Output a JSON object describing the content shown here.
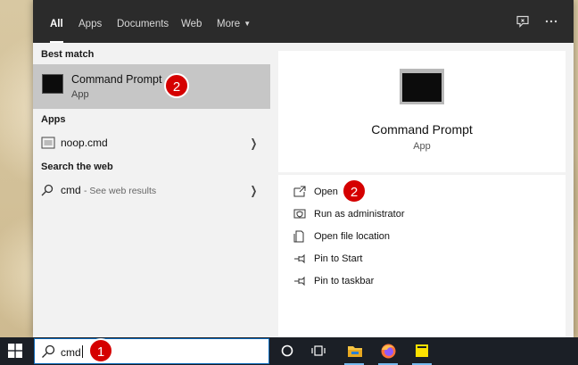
{
  "search_panel": {
    "tabs": [
      {
        "label": "All",
        "active": true
      },
      {
        "label": "Apps"
      },
      {
        "label": "Documents"
      },
      {
        "label": "Web"
      },
      {
        "label": "More"
      }
    ],
    "icons": {
      "feedback": "feedback-icon",
      "more": "more-options-icon"
    }
  },
  "results": {
    "best_match_header": "Best match",
    "best_match": {
      "title": "Command Prompt",
      "subtitle": "App",
      "badge": "2"
    },
    "apps_header": "Apps",
    "apps": [
      {
        "name": "noop.cmd"
      }
    ],
    "web_header": "Search the web",
    "web": {
      "query": "cmd",
      "hint": "- See web results"
    }
  },
  "details": {
    "title": "Command Prompt",
    "subtitle": "App",
    "actions": [
      {
        "label": "Open",
        "icon": "open-icon"
      },
      {
        "label": "Run as administrator",
        "icon": "shield-icon"
      },
      {
        "label": "Open file location",
        "icon": "file-location-icon"
      },
      {
        "label": "Pin to Start",
        "icon": "pin-icon"
      },
      {
        "label": "Pin to taskbar",
        "icon": "pin-icon"
      }
    ],
    "open_badge": "2"
  },
  "taskbar": {
    "search_value": "cmd",
    "search_badge": "1",
    "apps": [
      "cortana",
      "task-view",
      "file-explorer",
      "firefox",
      "sticky-notes"
    ]
  },
  "colors": {
    "badge": "#d50000",
    "taskbar": "#1b1f26",
    "topbar": "#2b2b2b",
    "highlight": "#c6c6c6"
  }
}
